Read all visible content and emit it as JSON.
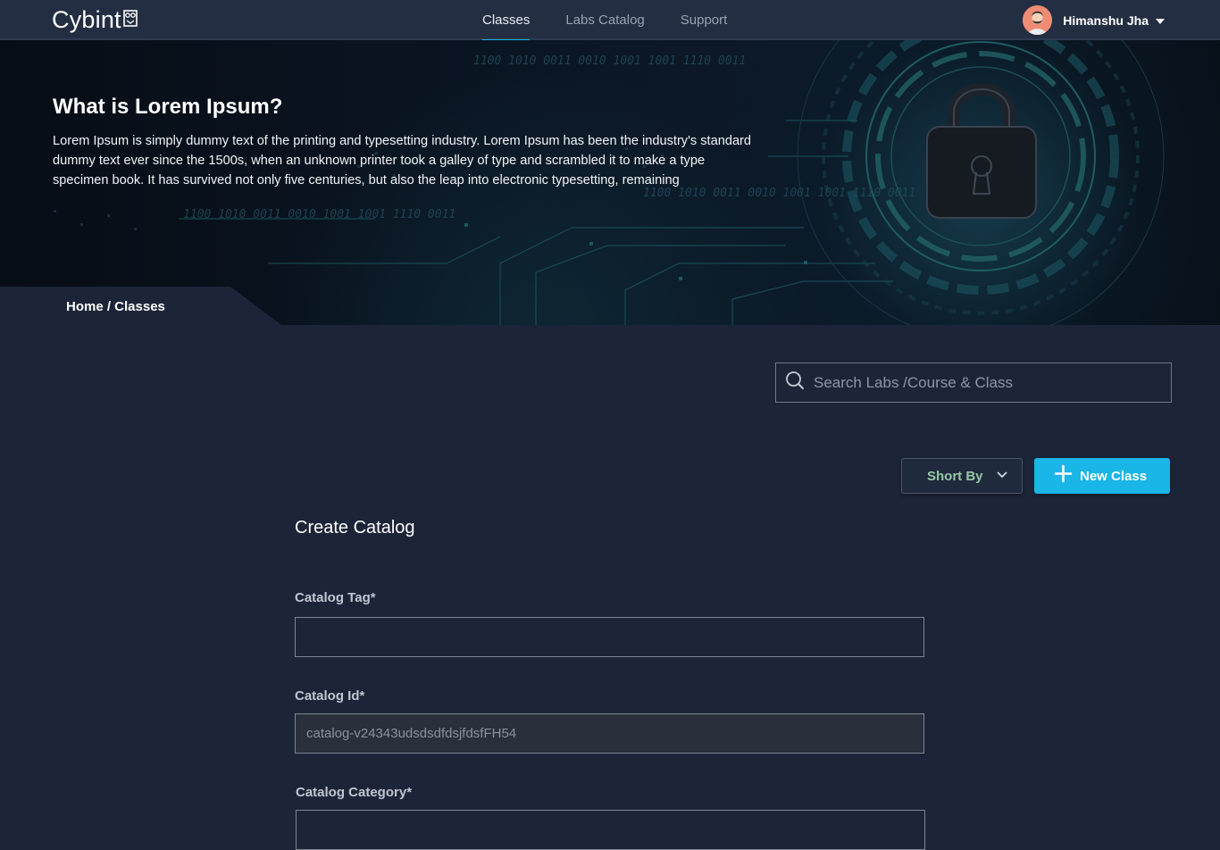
{
  "app": {
    "logo_text": "Cybint"
  },
  "nav": {
    "links": [
      {
        "label": "Classes",
        "active": true
      },
      {
        "label": "Labs Catalog",
        "active": false
      },
      {
        "label": "Support",
        "active": false
      }
    ],
    "user_name": "Himanshu Jha"
  },
  "hero": {
    "title": "What is Lorem Ipsum?",
    "text": "Lorem Ipsum is simply dummy text of the printing and typesetting industry. Lorem Ipsum has been the industry's standard dummy text ever since the 1500s, when an unknown printer took a galley of type and scrambled it to make a type specimen book. It has survived not only five centuries, but also the leap into electronic typesetting, remaining",
    "binary_1": "1100 1010 0011 0010 1001 1001 1110 0011",
    "binary_2": "1100 1010 0011 0010 1001 1001 1110 0011",
    "binary_3": "1100 1010 0011 0010 1001 1001 1110 0011"
  },
  "breadcrumb": {
    "text": "Home / Classes"
  },
  "search": {
    "placeholder": "Search Labs /Course & Class",
    "value": ""
  },
  "toolbar": {
    "sort_label": "Short By",
    "new_class_label": "New Class"
  },
  "form": {
    "title": "Create Catalog",
    "catalog_tag_label": "Catalog Tag*",
    "catalog_tag_value": "",
    "catalog_id_label": "Catalog Id*",
    "catalog_id_value": "catalog-v24343udsdsdfdsjfdsfFH54",
    "catalog_category_label": "Catalog Category*"
  },
  "colors": {
    "accent": "#1ab6e8",
    "background": "#1c2538",
    "nav_background": "#232e42",
    "sort_label": "#97c8a6"
  },
  "icons": {
    "logo": "owl-icon",
    "search": "search-icon",
    "sort": "chevron-down-icon",
    "new_class": "plus-icon",
    "user_menu": "caret-down-icon",
    "hero": "padlock-icon"
  }
}
